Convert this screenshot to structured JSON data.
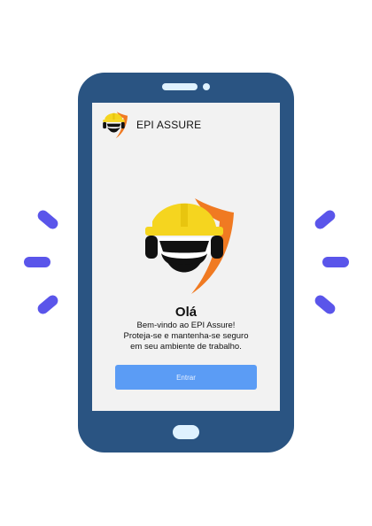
{
  "app": {
    "title": "EPI ASSURE"
  },
  "welcome": {
    "greeting": "Olá",
    "line1": "Bem-vindo ao EPI Assure!",
    "line2": "Proteja-se e mantenha-se seguro",
    "line3": "em seu ambiente de trabalho."
  },
  "actions": {
    "enter_label": "Entrar"
  },
  "icons": {
    "logo": "hard-hat-worker-shield-icon"
  },
  "colors": {
    "phone_body": "#2a5482",
    "screen_bg": "#f2f2f2",
    "button": "#5b9cf5",
    "accent_dash": "#5a55ea",
    "helmet": "#f5d51f",
    "shield": "#f07a22"
  }
}
